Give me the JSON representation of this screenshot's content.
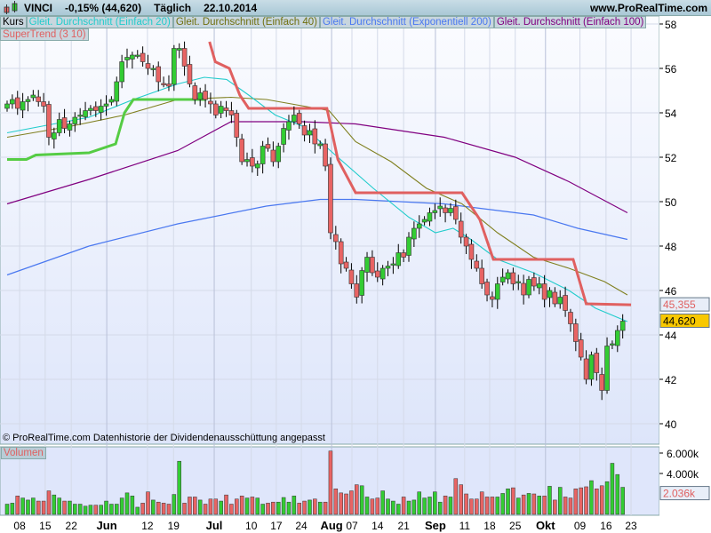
{
  "header": {
    "symbol": "VINCI",
    "change": "-0,15% (44,620)",
    "period": "Täglich",
    "date": "22.10.2014",
    "site": "www.ProRealTime.com"
  },
  "legend": {
    "kurs": "Kurs",
    "sma20": "Gleit. Durchschnitt (Einfach 20)",
    "sma40": "Gleit. Durchschnitt (Einfach 40)",
    "ema200": "Gleit. Durchschnitt (Exponentiell 200)",
    "sma100": "Gleit. Durchschnitt (Einfach 100)",
    "supertrend": "SuperTrend (3 10)",
    "volume": "Volumen"
  },
  "footer_note": "© ProRealTime.com  Datenhistorie der Dividendenausschüttung angepasst",
  "colors": {
    "up": "#33cc33",
    "down": "#e86464",
    "sma20": "#22cccc",
    "sma40": "#808020",
    "ema200": "#4a78f0",
    "sma100": "#800080",
    "st_up": "#55cc44",
    "st_down": "#e06060",
    "bg": "#e6ecfb"
  },
  "chart_data": {
    "type": "candlestick",
    "ylim": [
      40,
      58
    ],
    "y_ticks": [
      "58",
      "56",
      "54",
      "52",
      "50",
      "48",
      "46",
      "44",
      "42",
      "40"
    ],
    "y_tick_values": [
      58,
      56,
      54,
      52,
      50,
      48,
      46,
      44,
      42,
      40
    ],
    "last_price_label": "44,620",
    "supertrend_label": "45,355",
    "close": [
      54.4,
      54.6,
      54.2,
      54.5,
      54.6,
      54.8,
      54.5,
      54.3,
      52.9,
      53.1,
      53.7,
      53.3,
      53.5,
      53.8,
      53.9,
      54.1,
      54.2,
      54.1,
      54.3,
      54.4,
      54.6,
      55.4,
      56.3,
      56.5,
      56.6,
      56.6,
      56.3,
      56.0,
      56.0,
      55.4,
      55.3,
      55.2,
      56.9,
      56.9,
      56.1,
      55.3,
      54.6,
      54.9,
      54.6,
      54.4,
      53.9,
      54.3,
      54.1,
      53.9,
      52.9,
      51.8,
      51.9,
      51.6,
      51.7,
      52.5,
      52.4,
      51.8,
      52.5,
      53.3,
      53.6,
      53.9,
      53.5,
      53.0,
      53.2,
      52.6,
      52.6,
      51.6,
      48.6,
      48.2,
      47.2,
      47.0,
      46.3,
      45.7,
      46.9,
      47.5,
      46.8,
      46.6,
      47.0,
      47.1,
      47.2,
      47.7,
      47.5,
      48.4,
      48.8,
      49.0,
      49.2,
      49.5,
      49.6,
      49.8,
      49.5,
      49.7,
      49.2,
      48.4,
      48.0,
      47.4,
      47.0,
      46.3,
      45.8,
      45.6,
      46.3,
      46.6,
      46.8,
      46.3,
      46.4,
      45.8,
      46.5,
      46.2,
      46.3,
      45.6,
      46.0,
      45.4,
      45.7,
      45.1,
      44.5,
      43.7,
      43.0,
      42.0,
      43.1,
      42.3,
      41.5,
      43.5,
      43.6,
      44.2,
      44.62
    ],
    "volume_k": [
      1000,
      1100,
      1800,
      1600,
      1400,
      1600,
      1300,
      1300,
      2300,
      1900,
      1600,
      1300,
      1300,
      1000,
      1000,
      800,
      900,
      900,
      900,
      1300,
      1000,
      1000,
      1600,
      2100,
      1800,
      700,
      1100,
      2200,
      1400,
      1200,
      1100,
      1000,
      1950,
      5200,
      1100,
      1700,
      1700,
      1400,
      1000,
      1500,
      1500,
      1300,
      1900,
      1000,
      1500,
      1800,
      1600,
      1700,
      1600,
      1000,
      1100,
      1200,
      1200,
      1650,
      1200,
      1800,
      1100,
      1300,
      1400,
      1500,
      1200,
      1200,
      6200,
      2500,
      2100,
      2000,
      2300,
      2900,
      2800,
      1700,
      1500,
      1600,
      2300,
      1500,
      1300,
      1000,
      1700,
      1300,
      1400,
      2200,
      1600,
      1700,
      2200,
      1200,
      1800,
      1700,
      3500,
      2900,
      2000,
      1500,
      1500,
      2200,
      1700,
      1700,
      1700,
      2050,
      2500,
      2600,
      1600,
      1900,
      2050,
      2000,
      1800,
      1800,
      2750,
      1400,
      2650,
      1700,
      1600,
      2500,
      2600,
      2700,
      3300,
      2500,
      2800,
      3200,
      5000,
      3900,
      2650,
      2036
    ],
    "volume_ticks": [
      "6.000k",
      "4.000k"
    ],
    "volume_tick_values": [
      6000,
      4000
    ],
    "volume_last_label": "2.036k",
    "x_ticks": [
      {
        "label": "08",
        "day": 2.4
      },
      {
        "label": "15",
        "day": 7.3
      },
      {
        "label": "22",
        "day": 12.3
      },
      {
        "label": "Jun",
        "day": 19.1,
        "bold": true
      },
      {
        "label": "12",
        "day": 26.9
      },
      {
        "label": "19",
        "day": 31.9
      },
      {
        "label": "Jul",
        "day": 39.7,
        "bold": true
      },
      {
        "label": "10",
        "day": 46.8
      },
      {
        "label": "17",
        "day": 51.6
      },
      {
        "label": "24",
        "day": 56.4
      },
      {
        "label": "Aug",
        "day": 62.2,
        "bold": true
      },
      {
        "label": "07",
        "day": 66.1
      },
      {
        "label": "14",
        "day": 71
      },
      {
        "label": "21",
        "day": 76
      },
      {
        "label": "Sep",
        "day": 82.1,
        "bold": true
      },
      {
        "label": "11",
        "day": 87.7
      },
      {
        "label": "18",
        "day": 92.5
      },
      {
        "label": "25",
        "day": 97.4
      },
      {
        "label": "Okt",
        "day": 103.2,
        "bold": true
      },
      {
        "label": "09",
        "day": 109.8
      },
      {
        "label": "16",
        "day": 114.8
      },
      {
        "label": "23",
        "day": 119.6
      }
    ],
    "lines": {
      "sma20": [
        [
          0,
          53.1
        ],
        [
          15.7,
          53.8
        ],
        [
          24.2,
          54.6
        ],
        [
          32.7,
          55.3
        ],
        [
          37.8,
          55.6
        ],
        [
          42.1,
          55.5
        ],
        [
          46.3,
          54.8
        ],
        [
          51.4,
          53.9
        ],
        [
          56.6,
          53.4
        ],
        [
          63.4,
          52.0
        ],
        [
          70.2,
          50.6
        ],
        [
          77,
          49.3
        ],
        [
          82.1,
          48.6
        ],
        [
          85.5,
          48.8
        ],
        [
          88.9,
          48.3
        ],
        [
          94,
          47.4
        ],
        [
          100.9,
          46.8
        ],
        [
          107.7,
          46.0
        ],
        [
          112.8,
          45.2
        ],
        [
          118.9,
          44.6
        ]
      ],
      "sma40": [
        [
          0,
          52.9
        ],
        [
          12.3,
          53.4
        ],
        [
          22.5,
          53.9
        ],
        [
          32.7,
          54.6
        ],
        [
          42.9,
          54.7
        ],
        [
          49.7,
          54.6
        ],
        [
          61.7,
          54.1
        ],
        [
          66.8,
          52.7
        ],
        [
          73.6,
          51.8
        ],
        [
          80.4,
          50.6
        ],
        [
          87.2,
          49.9
        ],
        [
          94,
          48.6
        ],
        [
          100.9,
          47.5
        ],
        [
          107.7,
          47.0
        ],
        [
          114.5,
          46.4
        ],
        [
          118.9,
          45.8
        ]
      ],
      "ema200": [
        [
          0,
          46.7
        ],
        [
          15.7,
          48.0
        ],
        [
          32.7,
          49.0
        ],
        [
          49.7,
          49.8
        ],
        [
          60,
          50.1
        ],
        [
          66.8,
          50.1
        ],
        [
          83.8,
          49.9
        ],
        [
          100.9,
          49.4
        ],
        [
          109.4,
          48.8
        ],
        [
          118.9,
          48.3
        ]
      ],
      "sma100": [
        [
          0,
          49.9
        ],
        [
          15.7,
          51.0
        ],
        [
          32.7,
          52.3
        ],
        [
          42.9,
          53.6
        ],
        [
          56.6,
          53.6
        ],
        [
          66.8,
          53.5
        ],
        [
          83.8,
          52.9
        ],
        [
          97.4,
          52.0
        ],
        [
          107.7,
          50.9
        ],
        [
          118.9,
          49.5
        ]
      ],
      "supertrend_up": [
        [
          0,
          51.9
        ],
        [
          3.7,
          51.9
        ],
        [
          5.5,
          52.1
        ],
        [
          15.7,
          52.2
        ],
        [
          20.8,
          52.6
        ],
        [
          22.5,
          54.0
        ],
        [
          24.2,
          54.6
        ],
        [
          38.2,
          54.6
        ]
      ],
      "supertrend_down": [
        [
          38.8,
          57.2
        ],
        [
          39.9,
          56.3
        ],
        [
          42.6,
          56.0
        ],
        [
          44.6,
          54.8
        ],
        [
          46.3,
          54.2
        ],
        [
          61.3,
          54.2
        ],
        [
          63.4,
          51.9
        ],
        [
          66.8,
          50.4
        ],
        [
          87.2,
          50.4
        ],
        [
          90.6,
          49.2
        ],
        [
          93.2,
          47.4
        ],
        [
          108.5,
          47.4
        ],
        [
          111,
          45.4
        ],
        [
          119.6,
          45.355
        ]
      ]
    }
  }
}
